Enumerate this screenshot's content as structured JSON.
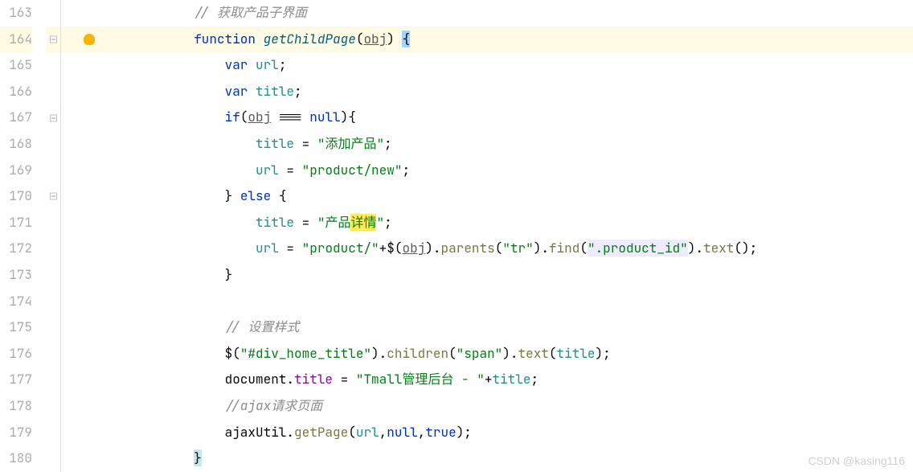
{
  "gutter": {
    "line_numbers": [
      "163",
      "164",
      "165",
      "166",
      "167",
      "168",
      "169",
      "170",
      "171",
      "172",
      "173",
      "174",
      "175",
      "176",
      "177",
      "178",
      "179",
      "180"
    ]
  },
  "code": {
    "l163": {
      "indent": "            ",
      "comment": "// 获取产品子界面"
    },
    "l164": {
      "indent": "            ",
      "kw_function": "function",
      "funcname": "getChildPage",
      "paren_open": "(",
      "param": "obj",
      "paren_close": ") ",
      "brace_open": "{"
    },
    "l165": {
      "indent": "                ",
      "kw_var": "var",
      "sp": " ",
      "ident": "url",
      "semi": ";"
    },
    "l166": {
      "indent": "                ",
      "kw_var": "var",
      "sp": " ",
      "ident": "title",
      "semi": ";"
    },
    "l167": {
      "indent": "                ",
      "kw_if": "if",
      "paren_open": "(",
      "param": "obj",
      "op": " === ",
      "nullkw": "null",
      "paren_close": ")",
      "brace_open": "{"
    },
    "l168": {
      "indent": "                    ",
      "ident": "title",
      "op": " = ",
      "str": "\"添加产品\"",
      "semi": ";"
    },
    "l169": {
      "indent": "                    ",
      "ident": "url",
      "op": " = ",
      "str": "\"product/new\"",
      "semi": ";"
    },
    "l170": {
      "indent": "                ",
      "brace_close": "}",
      "sp": " ",
      "kw_else": "else",
      "sp2": " ",
      "brace_open": "{"
    },
    "l171": {
      "indent": "                    ",
      "ident": "title",
      "op": " = ",
      "str_a": "\"产品",
      "str_hl": "详情",
      "str_b": "\"",
      "semi": ";"
    },
    "l172": {
      "indent": "                    ",
      "ident": "url",
      "op": " = ",
      "str": "\"product/\"",
      "plus": "+",
      "jq": "$",
      "paren_open": "(",
      "param": "obj",
      "paren_close": ")",
      "dot1": ".",
      "m1": "parents",
      "p1o": "(",
      "s1": "\"tr\"",
      "p1c": ")",
      "dot2": ".",
      "m2": "find",
      "p2o": "(",
      "s2": "\".product_id\"",
      "p2c": ")",
      "dot3": ".",
      "m3": "text",
      "p3o": "(",
      "p3c": ")",
      "semi": ";"
    },
    "l173": {
      "indent": "                ",
      "brace_close": "}"
    },
    "l174": {
      "indent": ""
    },
    "l175": {
      "indent": "                ",
      "comment": "// 设置样式"
    },
    "l176": {
      "indent": "                ",
      "jq": "$",
      "paren_open": "(",
      "str": "\"#div_home_title\"",
      "paren_close": ")",
      "dot1": ".",
      "m1": "children",
      "p1o": "(",
      "s1": "\"span\"",
      "p1c": ")",
      "dot2": ".",
      "m2": "text",
      "p2o": "(",
      "ident": "title",
      "p2c": ")",
      "semi": ";"
    },
    "l177": {
      "indent": "                ",
      "doc": "document",
      "dot": ".",
      "prop": "title",
      "op": " = ",
      "str": "\"Tmall管理后台 - \"",
      "plus": "+",
      "ident": "title",
      "semi": ";"
    },
    "l178": {
      "indent": "                ",
      "comment": "//ajax请求页面"
    },
    "l179": {
      "indent": "                ",
      "obj": "ajaxUtil",
      "dot": ".",
      "method": "getPage",
      "paren_open": "(",
      "a1": "url",
      "c1": ",",
      "nullkw": "null",
      "c2": ",",
      "boolkw": "true",
      "paren_close": ")",
      "semi": ";"
    },
    "l180": {
      "indent": "            ",
      "brace_close": "}"
    }
  },
  "watermark": "CSDN @kasing116"
}
